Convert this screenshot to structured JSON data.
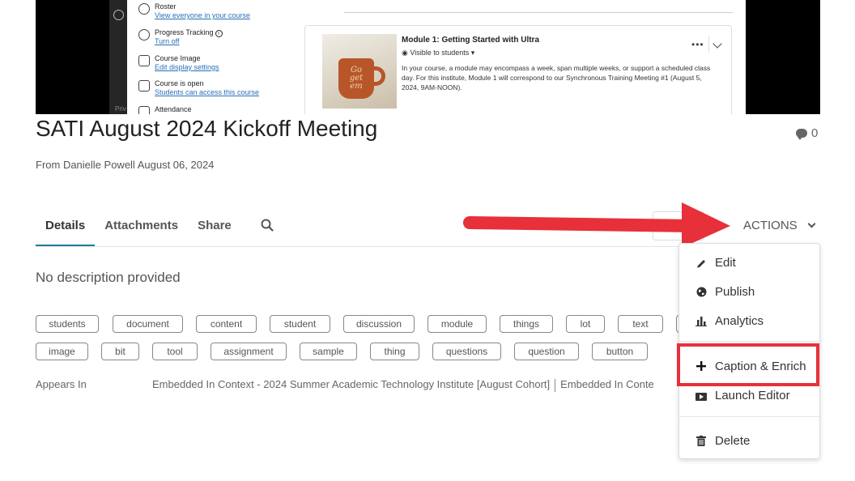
{
  "video": {
    "course_panel": [
      {
        "title": "Roster",
        "link": "View everyone in your course",
        "icon": "person-icon"
      },
      {
        "title": "Progress Tracking",
        "link": "Turn off",
        "icon": "progress-check-icon",
        "info": "i"
      },
      {
        "title": "Course Image",
        "link": "Edit display settings",
        "icon": "image-icon"
      },
      {
        "title": "Course is open",
        "link": "Students can access this course",
        "icon": "lock-open-icon"
      },
      {
        "title": "Attendance",
        "link": "",
        "icon": "calendar-icon"
      }
    ],
    "privacy_text": "Priv",
    "module": {
      "title": "Module 1: Getting Started with Ultra",
      "visibility": "Visible to students ▾",
      "description": "In your course, a module may encompass a week, span multiple weeks, or support a scheduled class day. For this institute, Module 1 will correspond to our Synchronous Training Meeting #1 (August 5, 2024, 9AM-NOON).",
      "more": "•••",
      "mug_text": "Go get em"
    }
  },
  "header": {
    "title": "SATI August 2024 Kickoff Meeting",
    "comment_count": "0",
    "byline": "From Danielle Powell August 06, 2024"
  },
  "tabs": [
    "Details",
    "Attachments",
    "Share"
  ],
  "actions_label": "ACTIONS",
  "description": "No description provided",
  "tags_row1": [
    "students",
    "document",
    "content",
    "student",
    "discussion",
    "module",
    "things",
    "lot",
    "text",
    ""
  ],
  "tags_row2": [
    "image",
    "bit",
    "tool",
    "assignment",
    "sample",
    "thing",
    "questions",
    "question",
    "button"
  ],
  "appears": {
    "label": "Appears In",
    "value1": "Embedded In Context - 2024 Summer Academic Technology Institute [August Cohort]",
    "value2": "Embedded In Conte"
  },
  "menu": {
    "items": [
      {
        "label": "Edit",
        "icon": "pencil-icon"
      },
      {
        "label": "Publish",
        "icon": "globe-icon"
      },
      {
        "label": "Analytics",
        "icon": "bar-chart-icon"
      },
      {
        "label": "Caption & Enrich",
        "icon": "plus-icon"
      },
      {
        "label": "Launch Editor",
        "icon": "film-icon"
      },
      {
        "label": "Delete",
        "icon": "trash-icon"
      }
    ]
  },
  "colors": {
    "accent_tab": "#1e7d9a",
    "highlight": "#e8303a",
    "link": "#2a6fb8"
  }
}
